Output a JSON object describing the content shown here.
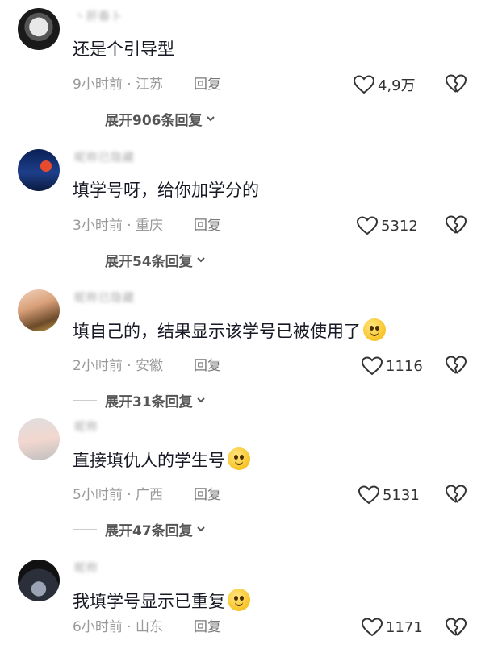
{
  "comments": [
    {
      "username": "丶肝春卜",
      "text": "还是个引导型",
      "emoji": "",
      "time_location": "9小时前 · 江苏",
      "reply_label": "回复",
      "likes": "4,9万",
      "expand_label": "展开906条回复"
    },
    {
      "username": "昵称已隐藏",
      "text": "填学号呀，给你加学分的",
      "emoji": "",
      "time_location": "3小时前 · 重庆",
      "reply_label": "回复",
      "likes": "5312",
      "expand_label": "展开54条回复"
    },
    {
      "username": "昵称已隐藏",
      "text": "填自己的，结果显示该学号已被使用了",
      "emoji": "smile-emoji",
      "time_location": "2小时前 · 安徽",
      "reply_label": "回复",
      "likes": "1116",
      "expand_label": "展开31条回复"
    },
    {
      "username": "昵称",
      "text": "直接填仇人的学生号",
      "emoji": "hands-over-mouth-emoji",
      "time_location": "5小时前 · 广西",
      "reply_label": "回复",
      "likes": "5131",
      "expand_label": "展开47条回复"
    },
    {
      "username": "昵称",
      "text": "我填学号显示已重复",
      "emoji": "smile-emoji",
      "time_location": "6小时前 · 山东",
      "reply_label": "回复",
      "likes": "1171",
      "expand_label": ""
    }
  ],
  "icons": {
    "like": "heart-outline-icon",
    "dislike": "broken-heart-icon",
    "expand": "chevron-down-icon"
  },
  "colors": {
    "text": "#161823",
    "meta": "#999999",
    "icon": "#333333"
  }
}
